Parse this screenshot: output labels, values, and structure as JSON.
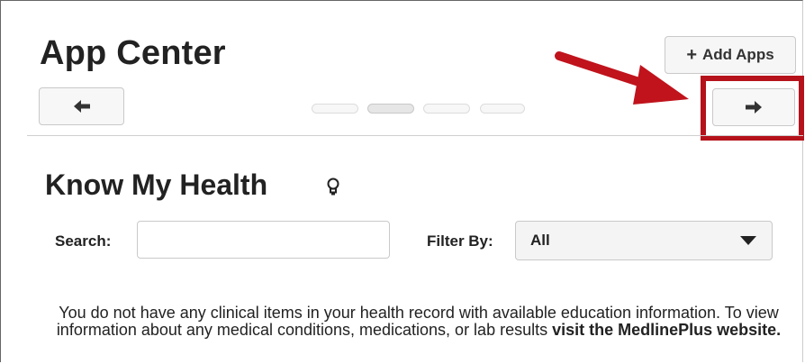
{
  "header": {
    "title": "App Center",
    "add_apps_plus": "+",
    "add_apps_label": "Add Apps"
  },
  "carousel": {
    "prev_icon": "arrow-left-icon",
    "next_icon": "arrow-right-icon",
    "page_count": 4,
    "active_page": 2
  },
  "section": {
    "title": "Know My Health",
    "icon": "lightbulb-icon"
  },
  "search": {
    "label": "Search:",
    "value": "",
    "placeholder": ""
  },
  "filter": {
    "label": "Filter By:",
    "selected": "All"
  },
  "message": {
    "text": "You do not have any clinical items in your health record with available education information.  To view information about any medical conditions, medications, or lab results",
    "link": "visit the MedlinePlus website."
  },
  "colors": {
    "highlight": "#b5121b",
    "annotation_arrow": "#c0131c"
  }
}
